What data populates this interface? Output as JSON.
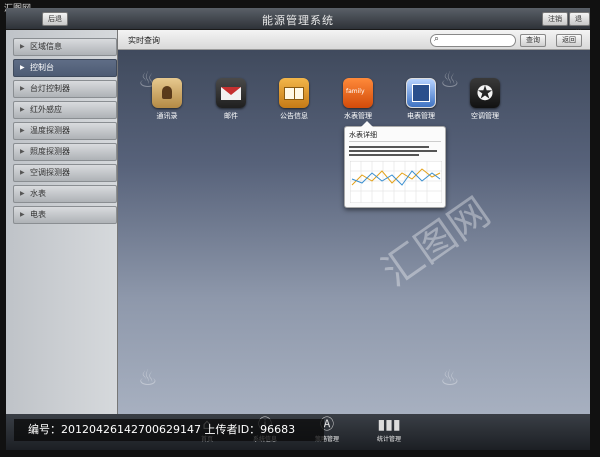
{
  "header": {
    "title": "能源管理系统",
    "back_label": "后退",
    "login_label": "注销",
    "exit_label": "退出"
  },
  "sidebar": {
    "items": [
      {
        "label": "区域信息",
        "active": false
      },
      {
        "label": "控制台",
        "active": true
      },
      {
        "label": "台灯控制器",
        "active": false
      },
      {
        "label": "红外感应",
        "active": false
      },
      {
        "label": "温度探测器",
        "active": false
      },
      {
        "label": "照度探测器",
        "active": false
      },
      {
        "label": "空调探测器",
        "active": false
      },
      {
        "label": "水表",
        "active": false
      },
      {
        "label": "电表",
        "active": false
      }
    ]
  },
  "main": {
    "breadcrumb": "实时查询",
    "search_placeholder": "",
    "query_label": "查询",
    "return_label": "返回",
    "apps": [
      {
        "label": "通讯录",
        "icon": "contacts-icon"
      },
      {
        "label": "邮件",
        "icon": "mail-icon"
      },
      {
        "label": "公告信息",
        "icon": "notice-book-icon"
      },
      {
        "label": "水表管理",
        "icon": "water-meter-icon",
        "badge": "family"
      },
      {
        "label": "电表管理",
        "icon": "electric-meter-icon"
      },
      {
        "label": "空调管理",
        "icon": "star-icon"
      }
    ],
    "popup": {
      "title": "水表详细"
    }
  },
  "bottom_tabs": [
    {
      "label": "首页",
      "icon": "home-icon"
    },
    {
      "label": "系统信息",
      "icon": "info-icon"
    },
    {
      "label": "策略管理",
      "icon": "appstore-icon"
    },
    {
      "label": "统计管理",
      "icon": "bar-chart-icon"
    }
  ],
  "footer": {
    "id_text": "编号：20120426142700629147 上传者ID：96683"
  },
  "colors": {
    "accent_active": "#5a6880",
    "main_bg_top": "#3c4658",
    "main_bg_bottom": "#a7b0c0"
  }
}
